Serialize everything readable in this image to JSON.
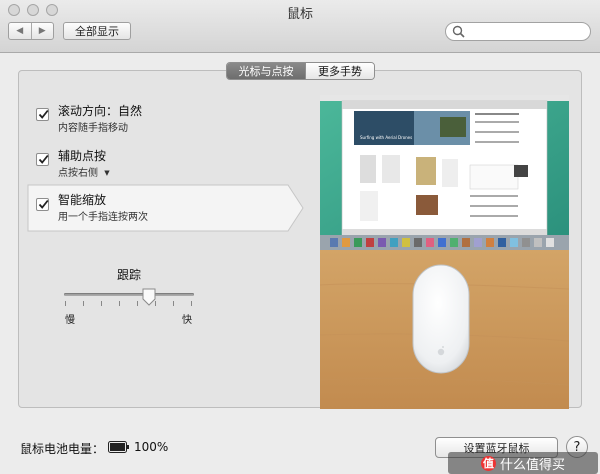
{
  "window": {
    "title": "鼠标"
  },
  "toolbar": {
    "back_icon": "◀",
    "forward_icon": "▶",
    "show_all_label": "全部显示",
    "search_placeholder": ""
  },
  "tabs": [
    {
      "label": "光标与点按",
      "active": true
    },
    {
      "label": "更多手势",
      "active": false
    }
  ],
  "options": [
    {
      "title": "滚动方向：自然",
      "subtitle": "内容随手指移动",
      "checked": true
    },
    {
      "title": "辅助点按",
      "subtitle": "点按右侧",
      "checked": true,
      "has_dropdown": true,
      "dropdown_icon": "▼"
    },
    {
      "title": "智能缩放",
      "subtitle": "用一个手指连按两次",
      "checked": true,
      "selected": true
    }
  ],
  "tracking": {
    "label": "跟踪",
    "min_label": "慢",
    "max_label": "快",
    "value": 0.65
  },
  "preview": {
    "site_heading": "Surfing with Aerial Drones"
  },
  "footer": {
    "battery_label": "鼠标电池电量：",
    "battery_percent": "100%",
    "battery_level": 1.0,
    "bluetooth_button_label": "设置蓝牙鼠标",
    "help_label": "?"
  },
  "watermark": {
    "icon_text": "值",
    "text": "什么值得买"
  },
  "colors": {
    "accent_tab": "#7a7a7a",
    "preview_bg": "#c9955a",
    "desktop_green": "#3aa98a",
    "dock": "#9aa4ad"
  }
}
